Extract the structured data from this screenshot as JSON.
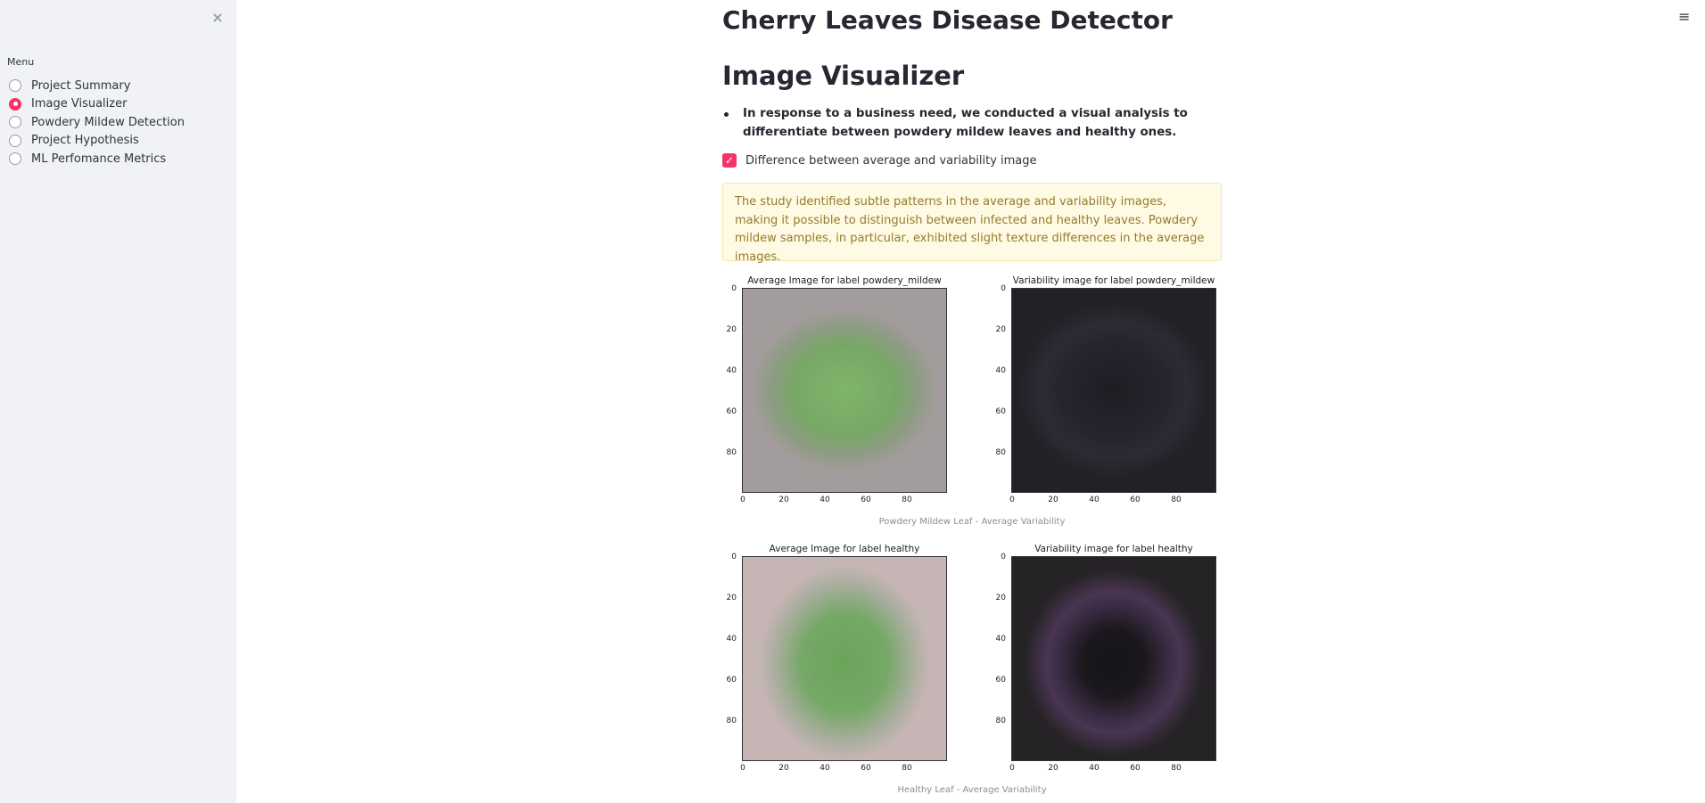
{
  "sidebar": {
    "close_icon": "×",
    "menu_title": "Menu",
    "items": [
      {
        "label": "Project Summary",
        "selected": false
      },
      {
        "label": "Image Visualizer",
        "selected": true
      },
      {
        "label": "Powdery Mildew Detection",
        "selected": false
      },
      {
        "label": "Project Hypothesis",
        "selected": false
      },
      {
        "label": "ML Perfomance Metrics",
        "selected": false
      }
    ]
  },
  "header": {
    "hamburger_icon": "≡"
  },
  "main": {
    "app_title": "Cherry Leaves Disease Detector",
    "section_title": "Image Visualizer",
    "bullet_text": "In response to a business need, we conducted a visual analysis to differentiate between powdery mildew leaves and healthy ones.",
    "checkbox_label": "Difference between average and variability image",
    "checkbox_checked": true,
    "info_text": "The study identified subtle patterns in the average and variability images, making it possible to distinguish between infected and healthy leaves. Powdery mildew samples, in particular, exhibited slight texture differences in the average images.",
    "accent_color": "#f63366"
  },
  "figures": [
    {
      "caption": "Powdery Mildew Leaf - Average Variability",
      "left_title": "Average Image for label powdery_mildew",
      "right_title": "Variability image for label powdery_mildew"
    },
    {
      "caption": "Healthy Leaf - Average Variability",
      "left_title": "Average Image for label healthy",
      "right_title": "Variability image for label healthy"
    }
  ],
  "axis_ticks": {
    "x": [
      "0",
      "20",
      "40",
      "60",
      "80"
    ],
    "y": [
      "0",
      "20",
      "40",
      "60",
      "80"
    ]
  }
}
